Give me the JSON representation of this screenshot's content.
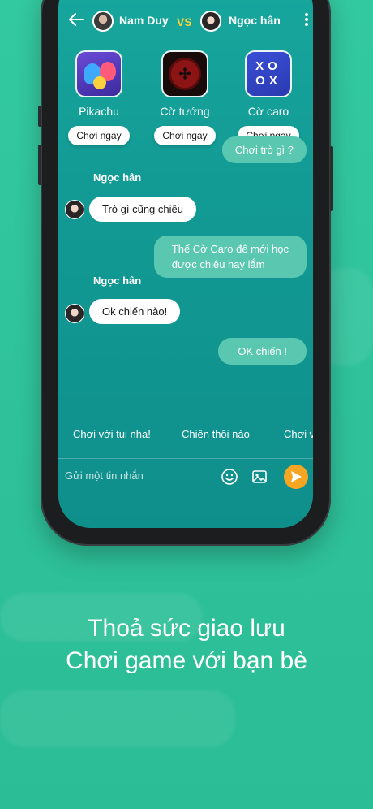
{
  "header": {
    "player1": "Nam Duy",
    "vs": "VS",
    "player2": "Ngọc hân"
  },
  "games": [
    {
      "name": "Pikachu",
      "button": "Chơi ngay"
    },
    {
      "name": "Cờ tướng",
      "button": "Chơi ngay"
    },
    {
      "name": "Cờ caro",
      "button": "Chơi ngay"
    }
  ],
  "caro_icon": "XOOX",
  "messages": [
    {
      "from": "me",
      "text": "Chơi trò gì ?"
    },
    {
      "from": "Ngọc hân",
      "text": "Trò gì cũng chiều"
    },
    {
      "from": "me",
      "text_line1": "Thế Cờ Caro đê mới học",
      "text_line2": "được chiêu hay lắm"
    },
    {
      "from": "Ngọc hân",
      "text": "Ok chiến nào!"
    },
    {
      "from": "me",
      "text": "OK chiến !"
    }
  ],
  "suggestions": [
    "Chơi với tui nha!",
    "Chiến thôi nào",
    "Chơi v"
  ],
  "composer": {
    "placeholder": "Gửi một tin nhắn"
  },
  "caption": {
    "line1": "Thoả sức giao lưu",
    "line2": "Chơi game với bạn bè"
  },
  "colors": {
    "accent": "#f6a623",
    "vs": "#f6d23c",
    "bg": "#33c9a0"
  }
}
